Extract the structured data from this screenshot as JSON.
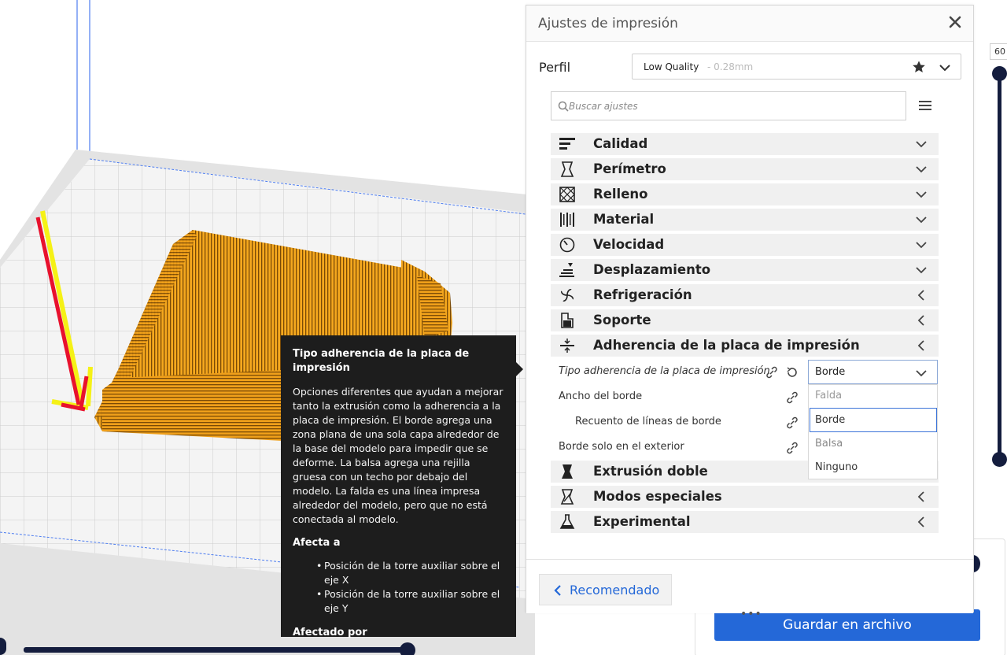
{
  "panel": {
    "title": "Ajustes de impresión",
    "profile_label": "Perfil",
    "profile_name": "Low Quality",
    "profile_sub": "- 0.28mm",
    "search_placeholder": "Buscar ajustes"
  },
  "categories": [
    {
      "label": "Calidad",
      "icon": "quality-icon",
      "state": "expand"
    },
    {
      "label": "Perímetro",
      "icon": "shell-icon",
      "state": "expand"
    },
    {
      "label": "Relleno",
      "icon": "infill-icon",
      "state": "expand"
    },
    {
      "label": "Material",
      "icon": "material-icon",
      "state": "expand"
    },
    {
      "label": "Velocidad",
      "icon": "speed-icon",
      "state": "expand"
    },
    {
      "label": "Desplazamiento",
      "icon": "travel-icon",
      "state": "expand"
    },
    {
      "label": "Refrigeración",
      "icon": "cooling-icon",
      "state": "collapse"
    },
    {
      "label": "Soporte",
      "icon": "support-icon",
      "state": "collapse"
    },
    {
      "label": "Adherencia de la placa de impresión",
      "icon": "adhesion-icon",
      "state": "collapse"
    },
    {
      "label": "Extrusión doble",
      "icon": "dual-extrusion-icon",
      "state": "none"
    },
    {
      "label": "Modos especiales",
      "icon": "special-modes-icon",
      "state": "collapse"
    },
    {
      "label": "Experimental",
      "icon": "experimental-icon",
      "state": "collapse"
    }
  ],
  "adhesion": {
    "type_label": "Tipo adherencia de la placa de impresión",
    "type_value": "Borde",
    "brim_width_label": "Ancho del borde",
    "brim_lines_label": "Recuento de líneas de borde",
    "brim_outside_label": "Borde solo en el exterior",
    "options": [
      "Falda",
      "Borde",
      "Balsa",
      "Ninguno"
    ],
    "selected_option": "Borde"
  },
  "tooltip": {
    "title": "Tipo adherencia de la placa de impresión",
    "description": "Opciones diferentes que ayudan a mejorar tanto la extrusión como la adherencia a la placa de impresión. El borde agrega una zona plana de una sola capa alrededor de la base del modelo para impedir que se deforme. La balsa agrega una rejilla gruesa con un techo por debajo del modelo. La falda es una línea impresa alrededor del modelo, pero que no está conectada al modelo.",
    "affects_heading": "Afecta a",
    "affects": [
      "Posición de la torre auxiliar sobre el eje X",
      "Posición de la torre auxiliar sobre el eje Y"
    ],
    "affected_by_heading": "Afectado por"
  },
  "footer": {
    "recommended_label": "Recomendado",
    "dots": "•••"
  },
  "layer_view": {
    "layer_number": "60"
  },
  "actions": {
    "save_label": "Guardar en archivo"
  },
  "colors": {
    "accent": "#2468d8",
    "model": "#f5a81e",
    "annotation_red": "#e8112d",
    "annotation_yellow": "#f5f116",
    "slider": "#141d3e"
  }
}
